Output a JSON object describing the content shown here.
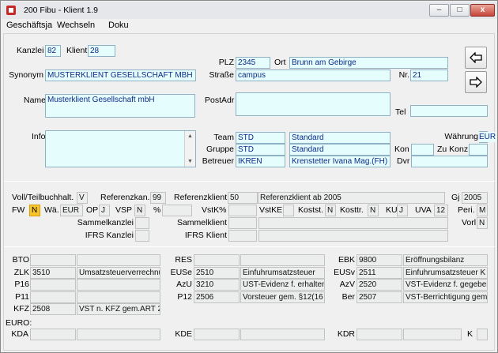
{
  "window": {
    "title": "200 Fibu - Klient 1.9",
    "min_glyph": "–",
    "max_glyph": "□",
    "close_glyph": "x"
  },
  "menu": [
    "Geschäftsja",
    "Wechseln",
    "Doku"
  ],
  "top": {
    "kanzlei_label": "Kanzlei",
    "kanzlei": "82",
    "klient_label": "Klient",
    "klient": "28",
    "plz_label": "PLZ",
    "plz": "2345",
    "ort_label": "Ort",
    "ort": "Brunn am Gebirge",
    "synonym_label": "Synonym",
    "synonym": "MUSTERKLIENT GESELLSCHAFT MBH",
    "strasse_label": "Straße",
    "strasse": "campus",
    "nr_label": "Nr.",
    "nr": "21",
    "name_label": "Name",
    "name": "Musterklient Gesellschaft mbH",
    "postadr_label": "PostAdr",
    "postadr": "",
    "tel_label": "Tel",
    "tel": "",
    "info_label": "Info",
    "info": "",
    "team_label": "Team",
    "team_code": "STD",
    "team_name": "Standard",
    "gruppe_label": "Gruppe",
    "gruppe_code": "STD",
    "gruppe_name": "Standard",
    "betreuer_label": "Betreuer",
    "betreuer_code": "IKREN",
    "betreuer_name": "Krenstetter Ivana Mag.(FH)",
    "waehrung_label": "Währung",
    "waehrung": "EUR",
    "kon_label": "Kon",
    "kon": "",
    "zukonz_label": "Zu Konz",
    "zukonz": "",
    "dvr_label": "Dvr",
    "dvr": ""
  },
  "settings": {
    "voll_label": "Voll/Teilbuchhalt.",
    "voll": "V",
    "refkanzlei_label": "Referenzkan.",
    "refkanzlei": "99",
    "refklient_label": "Referenzklient",
    "refklient": "50",
    "refklient_name": "Referenzklient ab 2005",
    "gj_label": "Gj",
    "gj": "2005",
    "fw_label": "FW",
    "fw": "N",
    "wae_label": "Wä.",
    "wae": "EUR",
    "op_label": "OP",
    "op": "J",
    "vsp_label": "VSP",
    "vsp": "N",
    "pct_label": "%",
    "pct": "",
    "vstk_label": "VstK%",
    "vstk": "",
    "vstke_label": "VstKE",
    "vstke": "",
    "kostst_label": "Kostst.",
    "kostst": "N",
    "kosttr_label": "Kosttr.",
    "kosttr": "N",
    "ku_label": "KU",
    "ku": "J",
    "uva_label": "UVA",
    "uva": "12",
    "peri_label": "Peri.",
    "peri": "M",
    "vorl_label": "Vorl",
    "vorl": "N",
    "sammelkanzlei_label": "Sammelkanzlei",
    "sammelkanzlei": "",
    "sammelklient_label": "Sammelklient",
    "sammelklient": "",
    "ifrskanzlei_label": "IFRS Kanzlei",
    "ifrskanzlei": "",
    "ifrsklient_label": "IFRS Klient",
    "ifrsklient": ""
  },
  "accounts": {
    "col1": [
      {
        "label": "BTO",
        "code": "",
        "desc": ""
      },
      {
        "label": "ZLK",
        "code": "3510",
        "desc": "Umsatzsteuerverrechnu"
      },
      {
        "label": "P16",
        "code": "",
        "desc": ""
      },
      {
        "label": "P11",
        "code": "",
        "desc": ""
      },
      {
        "label": "KFZ",
        "code": "2508",
        "desc": "VST n. KFZ gem.ART 2"
      }
    ],
    "col2": [
      {
        "label": "RES",
        "code": "",
        "desc": ""
      },
      {
        "label": "EUSe",
        "code": "2510",
        "desc": "Einfuhrumsatzsteuer"
      },
      {
        "label": "AzU",
        "code": "3210",
        "desc": "UST-Evidenz f. erhalten"
      },
      {
        "label": "P12",
        "code": "2506",
        "desc": "Vorsteuer gem. §12(16"
      }
    ],
    "col3": [
      {
        "label": "EBK",
        "code": "9800",
        "desc": "Eröffnungsbilanz"
      },
      {
        "label": "EUSv",
        "code": "2511",
        "desc": "Einfuhrumsatzsteuer K"
      },
      {
        "label": "AzV",
        "code": "2520",
        "desc": "VST-Evidenz f. gegeber"
      },
      {
        "label": "Ber",
        "code": "2507",
        "desc": "VST-Berrichtigung gem"
      }
    ]
  },
  "euro": {
    "heading": "EURO:",
    "kda_label": "KDA",
    "kda_code": "",
    "kda_desc": "",
    "kde_label": "KDE",
    "kde_code": "",
    "kde_desc": "",
    "kdr_label": "KDR",
    "kdr_code": "",
    "kdr_desc": "",
    "k_label": "K",
    "k": ""
  },
  "icons": {
    "prev": "arrow-left-icon",
    "next": "arrow-right-icon"
  },
  "colors": {
    "field_border": "#8fb3c4",
    "field_cyan": "#e6fdfd",
    "field_text": "#0b2a8a",
    "highlight": "#f7c52b"
  }
}
